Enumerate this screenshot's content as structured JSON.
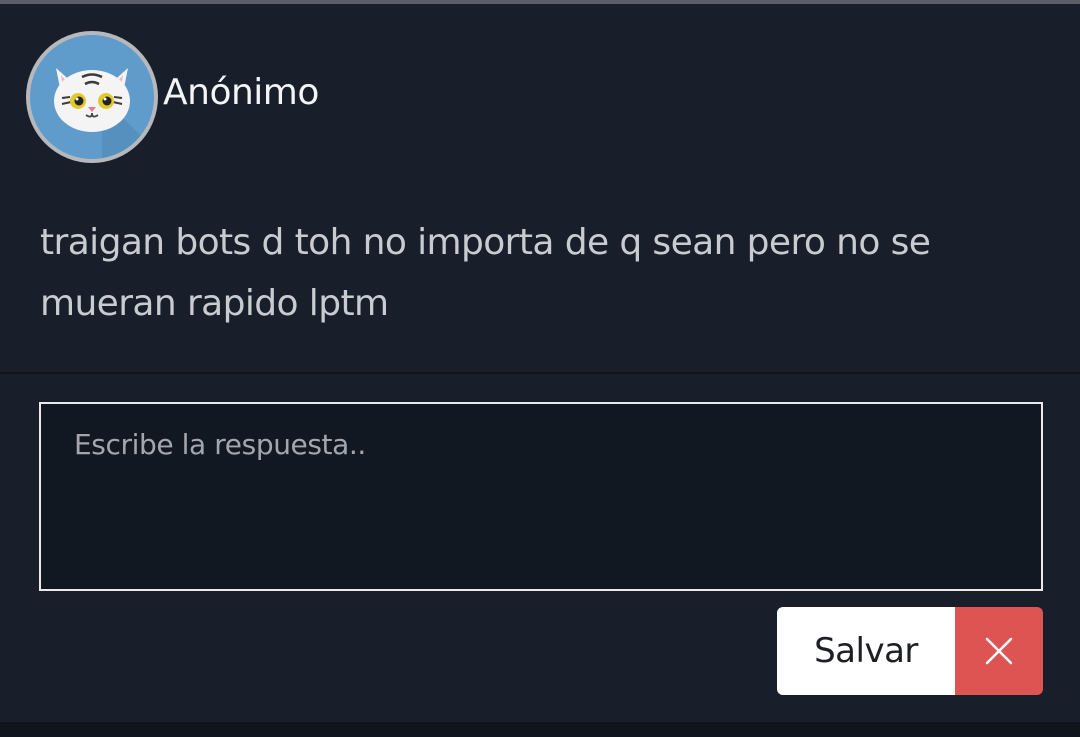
{
  "post": {
    "author": "Anónimo",
    "avatar_icon": "cat-avatar-icon",
    "text": "traigan bots d toh no importa de q sean pero no se mueran rapido lptm"
  },
  "reply": {
    "placeholder": "Escribe la respuesta..",
    "value": ""
  },
  "actions": {
    "save_label": "Salvar",
    "close_icon": "close-icon"
  },
  "colors": {
    "background": "#181f2b",
    "textarea_background": "#121821",
    "avatar_background": "#5f9ccc",
    "close_button": "#de5452",
    "save_button": "#ffffff"
  }
}
